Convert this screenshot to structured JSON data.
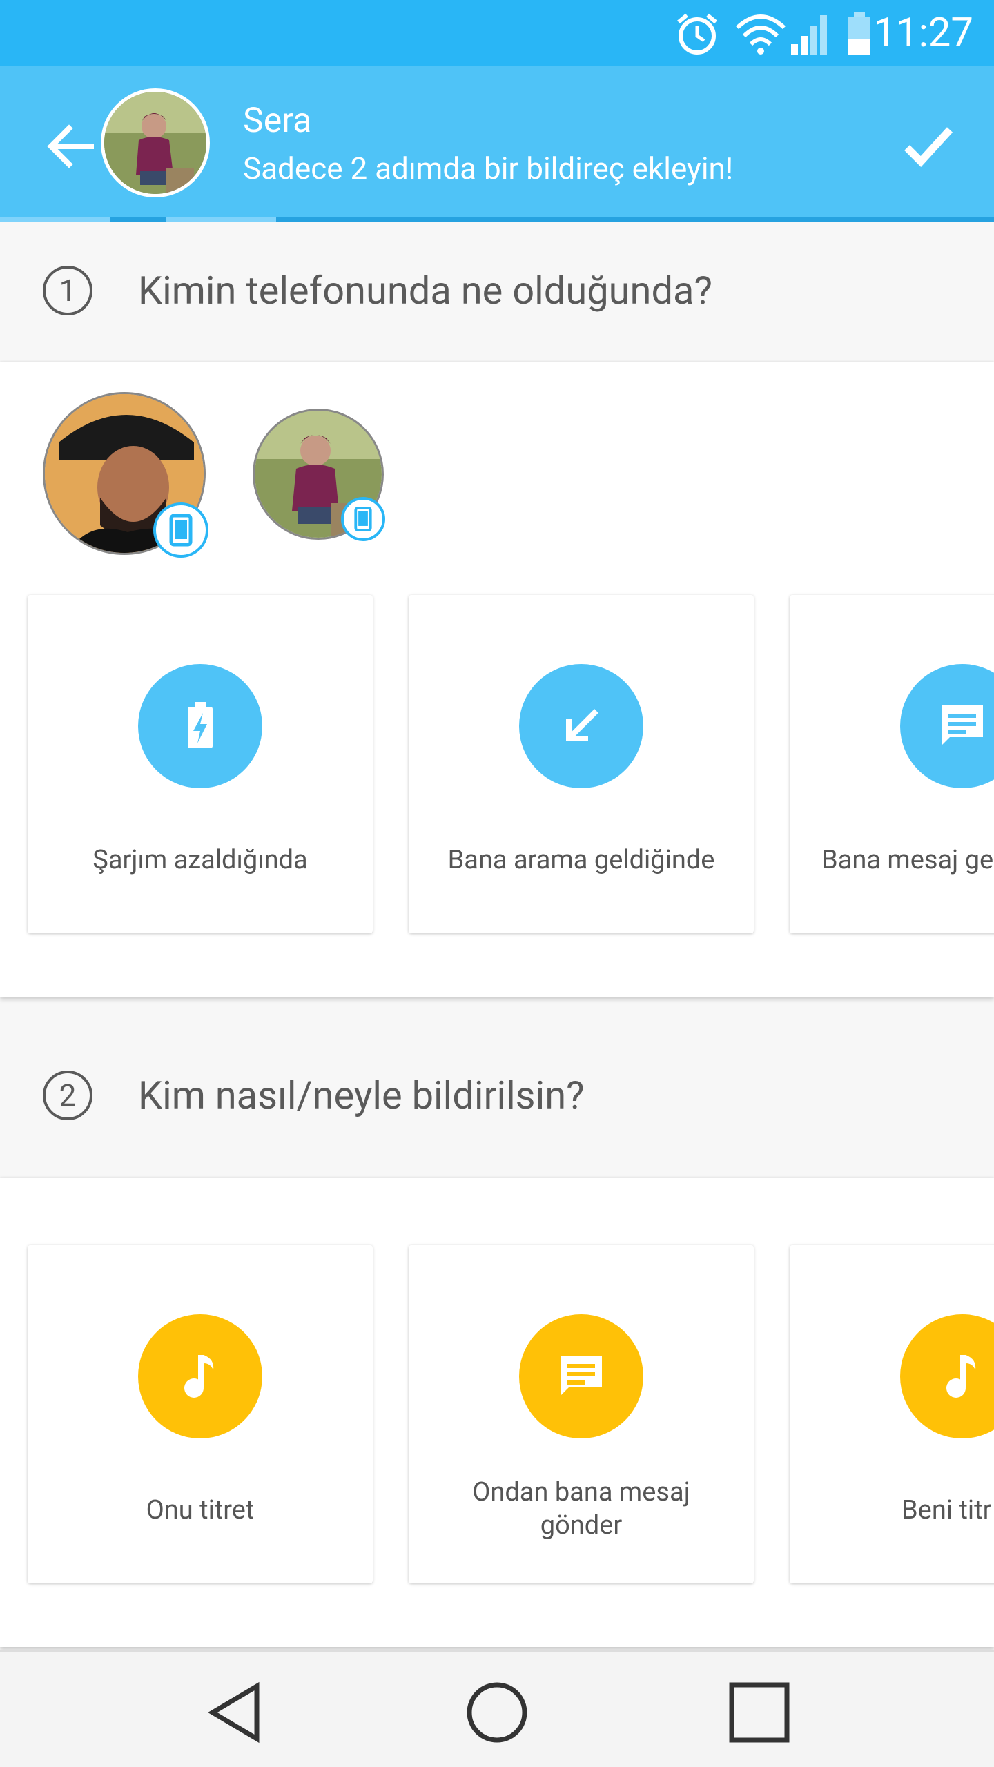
{
  "status_bar": {
    "time": "11:27",
    "icons": [
      "alarm-icon",
      "wifi-icon",
      "signal-icon",
      "battery-icon"
    ]
  },
  "header": {
    "title": "Sera",
    "subtitle": "Sadece 2 adımda bir bildireç ekleyin!",
    "back_icon": "arrow-back-icon",
    "done_icon": "check-icon"
  },
  "step1": {
    "number": "1",
    "question": "Kimin telefonunda ne olduğunda?",
    "people": [
      {
        "name": "person-1",
        "device_icon": "phone-icon"
      },
      {
        "name": "person-2",
        "device_icon": "phone-icon"
      }
    ],
    "cards": [
      {
        "label": "Şarjım azaldığında",
        "icon": "battery-charging-icon"
      },
      {
        "label": "Bana arama geldiğinde",
        "icon": "incoming-call-arrow-icon"
      },
      {
        "label": "Bana mesaj ge",
        "icon": "message-icon"
      }
    ]
  },
  "step2": {
    "number": "2",
    "question": "Kim nasıl/neyle bildirilsin?",
    "cards": [
      {
        "label": "Onu titret",
        "icon": "music-note-icon"
      },
      {
        "label_line1": "Ondan bana mesaj",
        "label_line2": "gönder",
        "icon": "message-icon"
      },
      {
        "label": "Beni titr",
        "icon": "music-note-icon"
      }
    ]
  },
  "colors": {
    "status_bar": "#29b6f6",
    "app_bar": "#4fc3f7",
    "trigger": "#4fc3f7",
    "action": "#ffc107"
  }
}
